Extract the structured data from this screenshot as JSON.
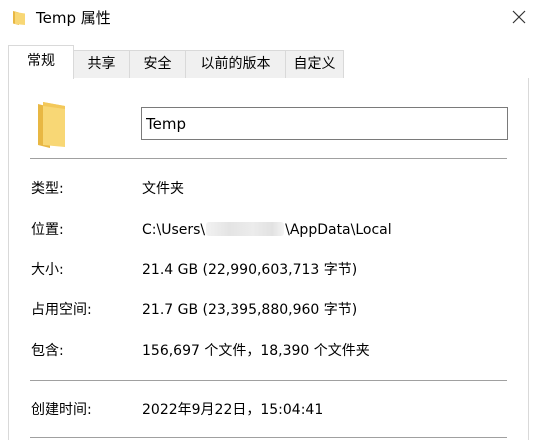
{
  "window": {
    "title": "Temp 属性",
    "title_icon": "folder-icon",
    "close_icon": "close-icon"
  },
  "tabs": [
    {
      "label": "常规",
      "active": true
    },
    {
      "label": "共享",
      "active": false
    },
    {
      "label": "安全",
      "active": false
    },
    {
      "label": "以前的版本",
      "active": false
    },
    {
      "label": "自定义",
      "active": false
    }
  ],
  "general": {
    "folder_icon": "folder-icon",
    "name_value": "Temp",
    "type_label": "类型:",
    "type_value": "文件夹",
    "location_label": "位置:",
    "location_prefix": "C:\\Users\\",
    "location_suffix": "\\AppData\\Local",
    "size_label": "大小:",
    "size_value": "21.4 GB (22,990,603,713 字节)",
    "size_on_disk_label": "占用空间:",
    "size_on_disk_value": "21.7 GB (23,395,880,960 字节)",
    "contains_label": "包含:",
    "contains_value": "156,697 个文件，18,390 个文件夹",
    "created_label": "创建时间:",
    "created_value": "2022年9月22日，15:04:41"
  },
  "colors": {
    "folder_body": "#f8d775",
    "folder_shade": "#e8b743",
    "tab_border": "#d9d9d9",
    "divider": "#a0a0a0"
  }
}
